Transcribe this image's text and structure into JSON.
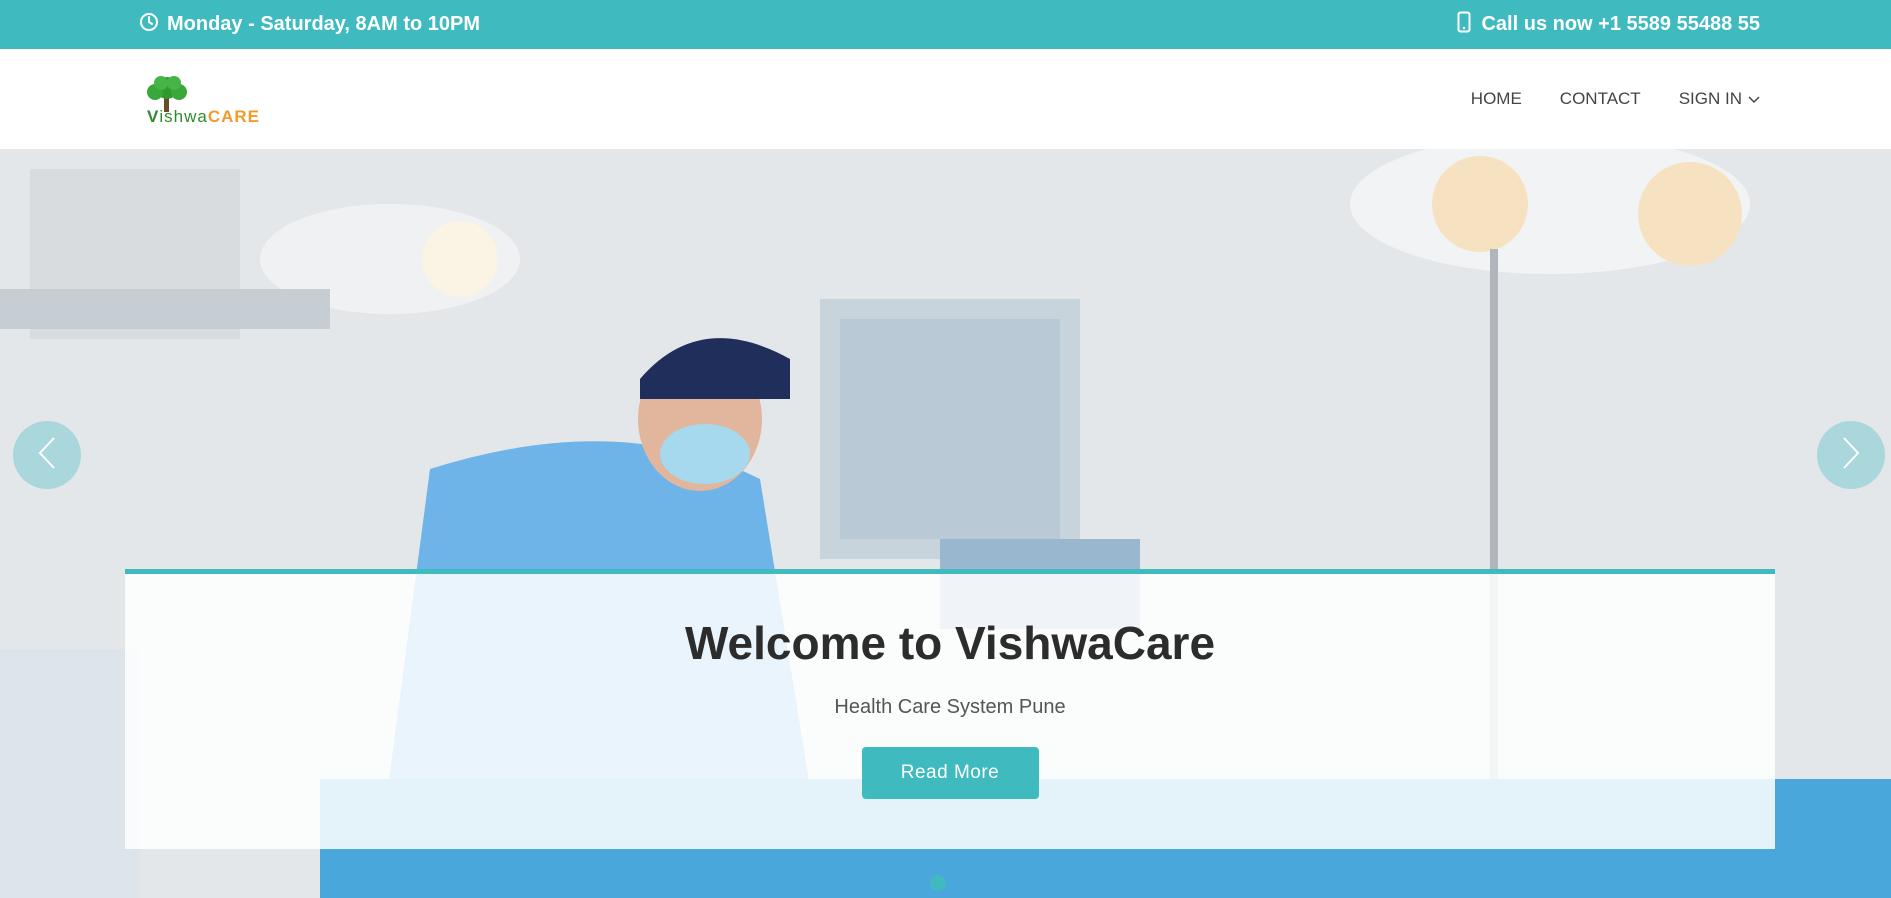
{
  "topbar": {
    "hours": "Monday - Saturday, 8AM to 10PM",
    "call": "Call us now +1 5589 55488 55"
  },
  "logo": {
    "v": "V",
    "shwa": "ishwa",
    "care": "CARE"
  },
  "nav": {
    "items": [
      {
        "label": "HOME"
      },
      {
        "label": "CONTACT"
      },
      {
        "label": "SIGN IN"
      }
    ]
  },
  "hero": {
    "title": "Welcome to VishwaCare",
    "subtitle": "Health Care System Pune",
    "button": "Read More"
  },
  "colors": {
    "accent": "#3fbbc0",
    "logo_green": "#2e8b2e",
    "logo_orange": "#f39a2b"
  }
}
